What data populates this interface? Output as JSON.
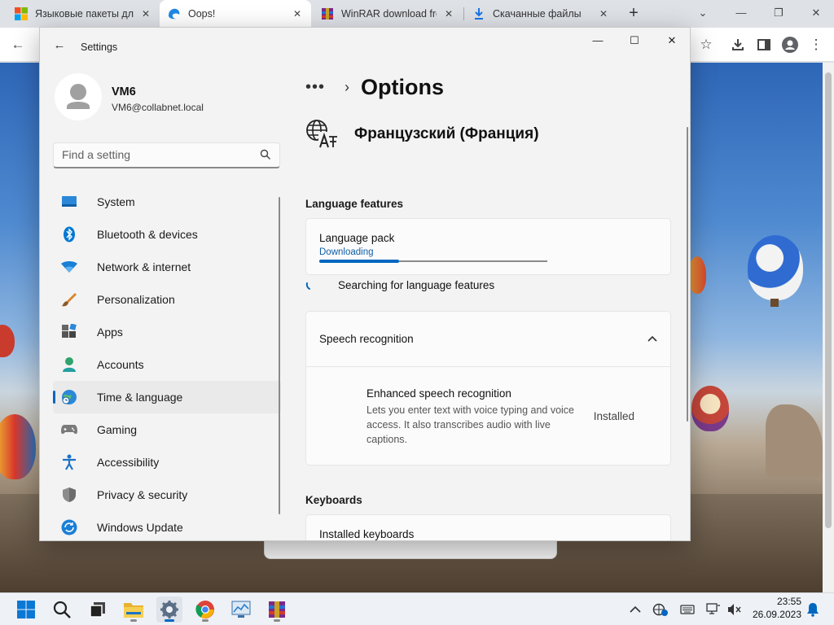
{
  "browser": {
    "tabs": [
      {
        "label": "Языковые пакеты для",
        "close": "✕",
        "icon": "windows-logo-icon"
      },
      {
        "label": "Oops!",
        "close": "✕",
        "icon": "edge-icon",
        "active": true
      },
      {
        "label": "WinRAR download free",
        "close": "✕",
        "icon": "winrar-icon"
      },
      {
        "label": "Скачанные файлы",
        "close": "✕",
        "icon": "download-icon"
      }
    ],
    "new_tab": "+"
  },
  "settings": {
    "window_title": "Settings",
    "user": {
      "name": "VM6",
      "email": "VM6@collabnet.local"
    },
    "search": {
      "placeholder": "Find a setting"
    },
    "nav": [
      {
        "label": "System",
        "icon": "system-icon"
      },
      {
        "label": "Bluetooth & devices",
        "icon": "bluetooth-icon"
      },
      {
        "label": "Network & internet",
        "icon": "wifi-icon"
      },
      {
        "label": "Personalization",
        "icon": "brush-icon"
      },
      {
        "label": "Apps",
        "icon": "apps-icon"
      },
      {
        "label": "Accounts",
        "icon": "accounts-icon"
      },
      {
        "label": "Time & language",
        "icon": "globe-clock-icon",
        "selected": true
      },
      {
        "label": "Gaming",
        "icon": "gamepad-icon"
      },
      {
        "label": "Accessibility",
        "icon": "accessibility-icon"
      },
      {
        "label": "Privacy & security",
        "icon": "shield-icon"
      },
      {
        "label": "Windows Update",
        "icon": "update-icon"
      }
    ],
    "breadcrumb": {
      "more": "•••",
      "title": "Options"
    },
    "language": {
      "name": "Французский (Франция)"
    },
    "language_features": {
      "heading": "Language features",
      "pack_label": "Language pack",
      "pack_status": "Downloading",
      "pack_progress": 0.35,
      "searching": "Searching for language features"
    },
    "speech": {
      "title": "Speech recognition",
      "enhanced_title": "Enhanced speech recognition",
      "enhanced_desc": "Lets you enter text with voice typing and voice access. It also transcribes audio with live captions.",
      "enhanced_status": "Installed"
    },
    "keyboards": {
      "heading": "Keyboards",
      "installed_label": "Installed keyboards"
    }
  },
  "taskbar": {
    "time": "23:55",
    "date": "26.09.2023",
    "accent": "#0067c0"
  }
}
